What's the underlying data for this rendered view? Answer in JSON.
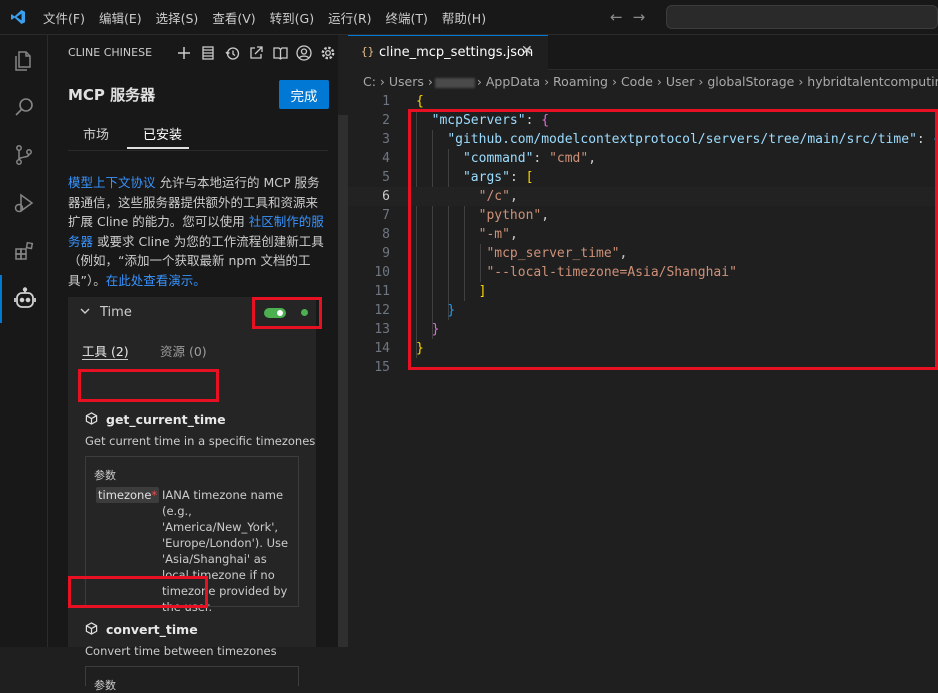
{
  "menu": [
    "文件(F)",
    "编辑(E)",
    "选择(S)",
    "查看(V)",
    "转到(G)",
    "运行(R)",
    "终端(T)",
    "帮助(H)"
  ],
  "activity_icons": [
    "explorer-icon",
    "search-icon",
    "source-control-icon",
    "run-debug-icon",
    "extensions-icon",
    "cline-robot-icon"
  ],
  "sidebar": {
    "title": "CLINE CHINESE",
    "header_icons": [
      "plus-icon",
      "database-icon",
      "history-icon",
      "popout-icon",
      "book-icon",
      "account-icon",
      "gear-icon"
    ]
  },
  "mcp": {
    "title": "MCP 服务器",
    "done_label": "完成",
    "tabs": [
      "市场",
      "已安装"
    ],
    "desc": {
      "link1": "模型上下文协议",
      "text1": " 允许与本地运行的 MCP 服务器通信，这些服务器提供额外的工具和资源来扩展 Cline 的能力。您可以使用 ",
      "link2": "社区制作的服务器",
      "text2": " 或要求 Cline 为您的工作流程创建新工具（例如，“添加一个获取最新 npm 文档的工具”）。",
      "link3": "在此处查看演示。"
    },
    "server": {
      "name": "Time",
      "enabled": true,
      "status_color": "#4caf50",
      "tabs": [
        "工具 (2)",
        "资源 (0)"
      ],
      "tools": [
        {
          "name": "get_current_time",
          "description": "Get current time in a specific timezones",
          "params_label": "参数",
          "param_name": "timezone",
          "param_required": "*",
          "param_desc": "IANA timezone name (e.g., 'America/New_York', 'Europe/London'). Use 'Asia/Shanghai' as local timezone if no timezone provided by the user."
        },
        {
          "name": "convert_time",
          "description": "Convert time between timezones",
          "params_label": "参数"
        }
      ]
    }
  },
  "editor": {
    "tab_icon": "{}",
    "tab_name": "cline_mcp_settings.json",
    "breadcrumb": {
      "part1": "C: › Users ›",
      "part2": "› AppData › Roaming › Code › User › globalStorage › hybridtalentcomputing."
    },
    "line_numbers": [
      "1",
      "2",
      "3",
      "4",
      "5",
      "6",
      "7",
      "8",
      "9",
      "10",
      "11",
      "12",
      "13",
      "14",
      "15"
    ],
    "current_line": 6,
    "code": {
      "l1": "{",
      "l2_key": "\"mcpServers\"",
      "l3_key": "\"github.com/modelcontextprotocol/servers/tree/main/src/time\"",
      "l4_key": "\"command\"",
      "l4_val": "\"cmd\"",
      "l5_key": "\"args\"",
      "l6": "\"/c\"",
      "l7": "\"python\"",
      "l8": "\"-m\"",
      "l9": "\"mcp_server_time\"",
      "l10": "\"--local-timezone=Asia/Shanghai\""
    }
  },
  "highlight_color": "#e81123"
}
